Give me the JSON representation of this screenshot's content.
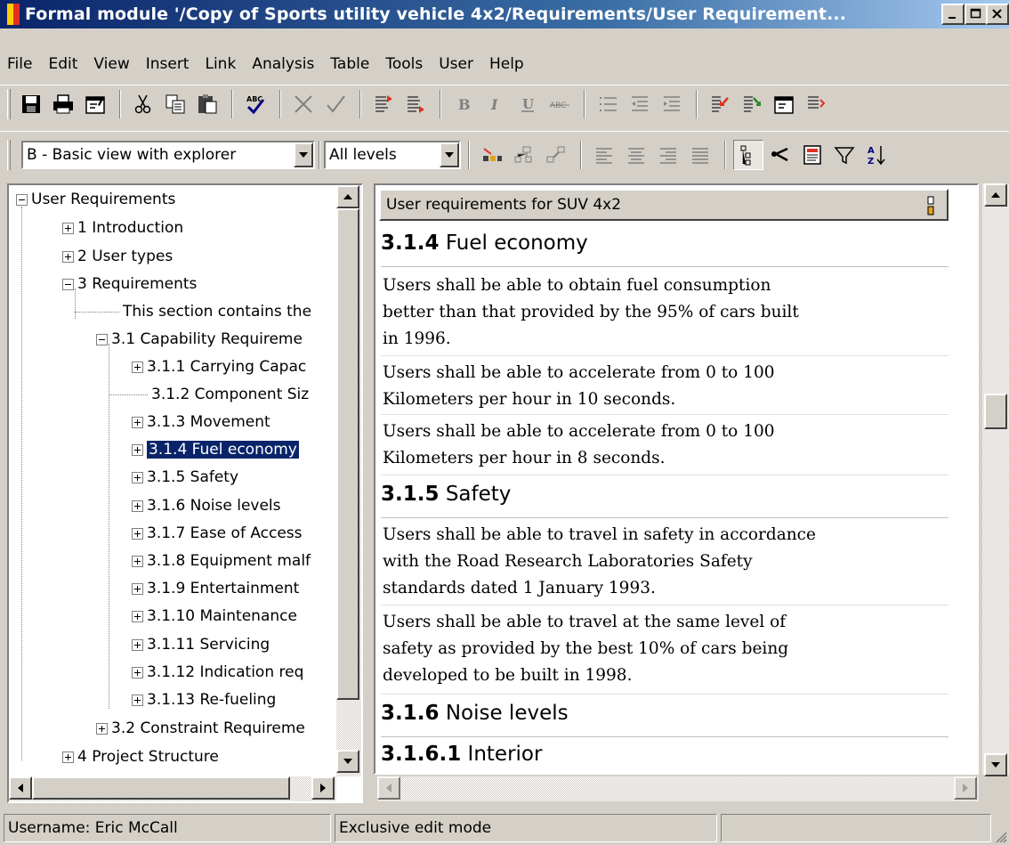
{
  "window": {
    "title": "Formal module '/Copy of Sports utility vehicle 4x2/Requirements/User Requirement..."
  },
  "menubar": [
    "File",
    "Edit",
    "View",
    "Insert",
    "Link",
    "Analysis",
    "Table",
    "Tools",
    "User",
    "Help"
  ],
  "toolbar2": {
    "view_selector": "B - Basic view with explorer",
    "level_selector": "All levels"
  },
  "tree": {
    "items": [
      "User Requirements",
      "1 Introduction",
      "2 User types",
      "3 Requirements",
      "This section contains the",
      "3.1 Capability Requireme",
      "3.1.1 Carrying Capac",
      "3.1.2 Component Siz",
      "3.1.3 Movement",
      "3.1.4 Fuel economy",
      "3.1.5 Safety",
      "3.1.6 Noise levels",
      "3.1.7 Ease of Access",
      "3.1.8 Equipment malf",
      "3.1.9 Entertainment",
      "3.1.10 Maintenance",
      "3.1.11 Servicing",
      "3.1.12 Indication req",
      "3.1.13 Re-fueling",
      "3.2 Constraint Requireme",
      "4 Project Structure"
    ],
    "selected": "3.1.4 Fuel economy"
  },
  "document": {
    "column_header": "User requirements for SUV 4x2",
    "rows": [
      {
        "num": "3.1.4",
        "title": "Fuel economy"
      },
      {
        "text": [
          "Users shall be able to obtain fuel consumption",
          "better than that provided by the 95% of cars built",
          "in 1996."
        ]
      },
      {
        "text": [
          "Users shall be able to accelerate from 0 to 100",
          "Kilometers per hour in 10 seconds."
        ]
      },
      {
        "text": [
          "Users shall be able to accelerate from 0 to 100",
          "Kilometers per hour in 8 seconds."
        ]
      },
      {
        "num": "3.1.5",
        "title": "Safety"
      },
      {
        "text": [
          "Users shall be able to travel in safety in accordance",
          "with the Road Research Laboratories Safety",
          "standards dated 1 January 1993."
        ]
      },
      {
        "text": [
          "Users shall be able to travel at the same level of",
          "safety as provided by the best 10% of cars being",
          "developed to be built in 1998."
        ]
      },
      {
        "num": "3.1.6",
        "title": "Noise levels"
      },
      {
        "num": "3.1.6.1",
        "title": "Interior"
      }
    ]
  },
  "status": {
    "user": "Username: Eric McCall",
    "mode": "Exclusive edit mode"
  },
  "colors": {
    "title_active": "#0a246a",
    "selection": "#0a246a",
    "face": "#d4d0c8"
  }
}
